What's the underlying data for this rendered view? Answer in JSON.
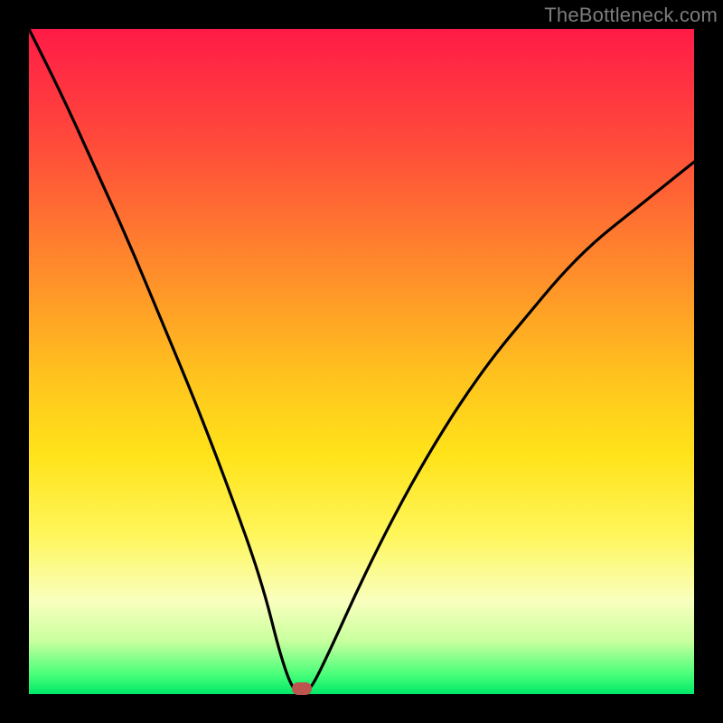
{
  "watermark": "TheBottleneck.com",
  "colors": {
    "background": "#000000",
    "gradient_top": "#ff1b47",
    "gradient_mid": "#ffe31a",
    "gradient_bottom": "#00e868",
    "curve": "#000000",
    "marker": "#bd554e"
  },
  "chart_data": {
    "type": "line",
    "title": "",
    "xlabel": "",
    "ylabel": "",
    "xlim": [
      0,
      100
    ],
    "ylim": [
      0,
      100
    ],
    "x": [
      0,
      5,
      10,
      15,
      20,
      25,
      30,
      35,
      38,
      40,
      42,
      45,
      50,
      55,
      60,
      65,
      70,
      75,
      80,
      85,
      90,
      95,
      100
    ],
    "values": [
      100,
      90,
      79,
      68,
      56,
      44,
      31,
      17,
      5,
      0,
      0,
      6,
      17,
      27,
      36,
      44,
      51,
      57,
      63,
      68,
      72,
      76,
      80
    ],
    "marker": {
      "x": 41,
      "y": 0
    },
    "notes": "V-shaped bottleneck curve; minimum (0) near x≈40; left branch reaches 100 at x=0; right branch rises to ≈80 at x=100."
  }
}
